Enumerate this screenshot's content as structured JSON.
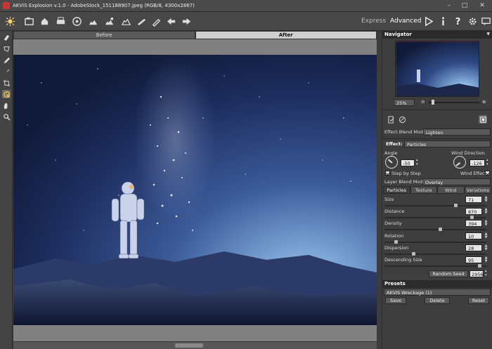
{
  "window": {
    "title": "AKVIS Explosion v.1.0 - AdobeStock_151188907.jpeg (RGB/8, 4300x2867)",
    "minimize": "–",
    "maximize": "□",
    "close": "✕"
  },
  "toolbar": {
    "modes": {
      "express": "Express",
      "advanced": "Advanced"
    }
  },
  "view_tabs": {
    "before": "Before",
    "after": "After"
  },
  "navigator": {
    "header": "Navigator",
    "zoom": "25%"
  },
  "effect_panel": {
    "effect_blend_mode_label": "Effect Blend Mode",
    "effect_blend_mode_value": "Lighten",
    "effect_label": "Effect:",
    "effect_value": "Particles",
    "angle_label": "Angle",
    "angle_value": "-50",
    "wind_direction_label": "Wind Direction",
    "wind_direction_value": "-126",
    "step_by_step_label": "Step by Step",
    "wind_effect_label": "Wind Effect",
    "layer_blend_mode_label": "Layer Blend Mode",
    "layer_blend_mode_value": "Overlay"
  },
  "param_tabs": [
    "Particles",
    "Texture",
    "Wind",
    "Variations"
  ],
  "params": [
    {
      "name": "Size",
      "value": "71",
      "level": 0.71
    },
    {
      "name": "Distance",
      "value": "870",
      "level": 0.87
    },
    {
      "name": "Density",
      "value": "394",
      "level": 0.55
    },
    {
      "name": "Rotation",
      "value": "10",
      "level": 0.1
    },
    {
      "name": "Dispersion",
      "value": "28",
      "level": 0.28
    },
    {
      "name": "Descending Size",
      "value": "95",
      "level": 0.95
    }
  ],
  "random_seed": {
    "label": "Random Seed",
    "value": "2956"
  },
  "presets": {
    "header": "Presets",
    "current": "AKVIS Wreckage (1)",
    "save": "Save",
    "delete": "Delete",
    "reset": "Reset"
  },
  "colors": {
    "panel_bg": "#3e3e3e",
    "header_bg": "#2b2b2b",
    "sky_dark": "#101a38",
    "sky_light": "#7fa8d8"
  }
}
